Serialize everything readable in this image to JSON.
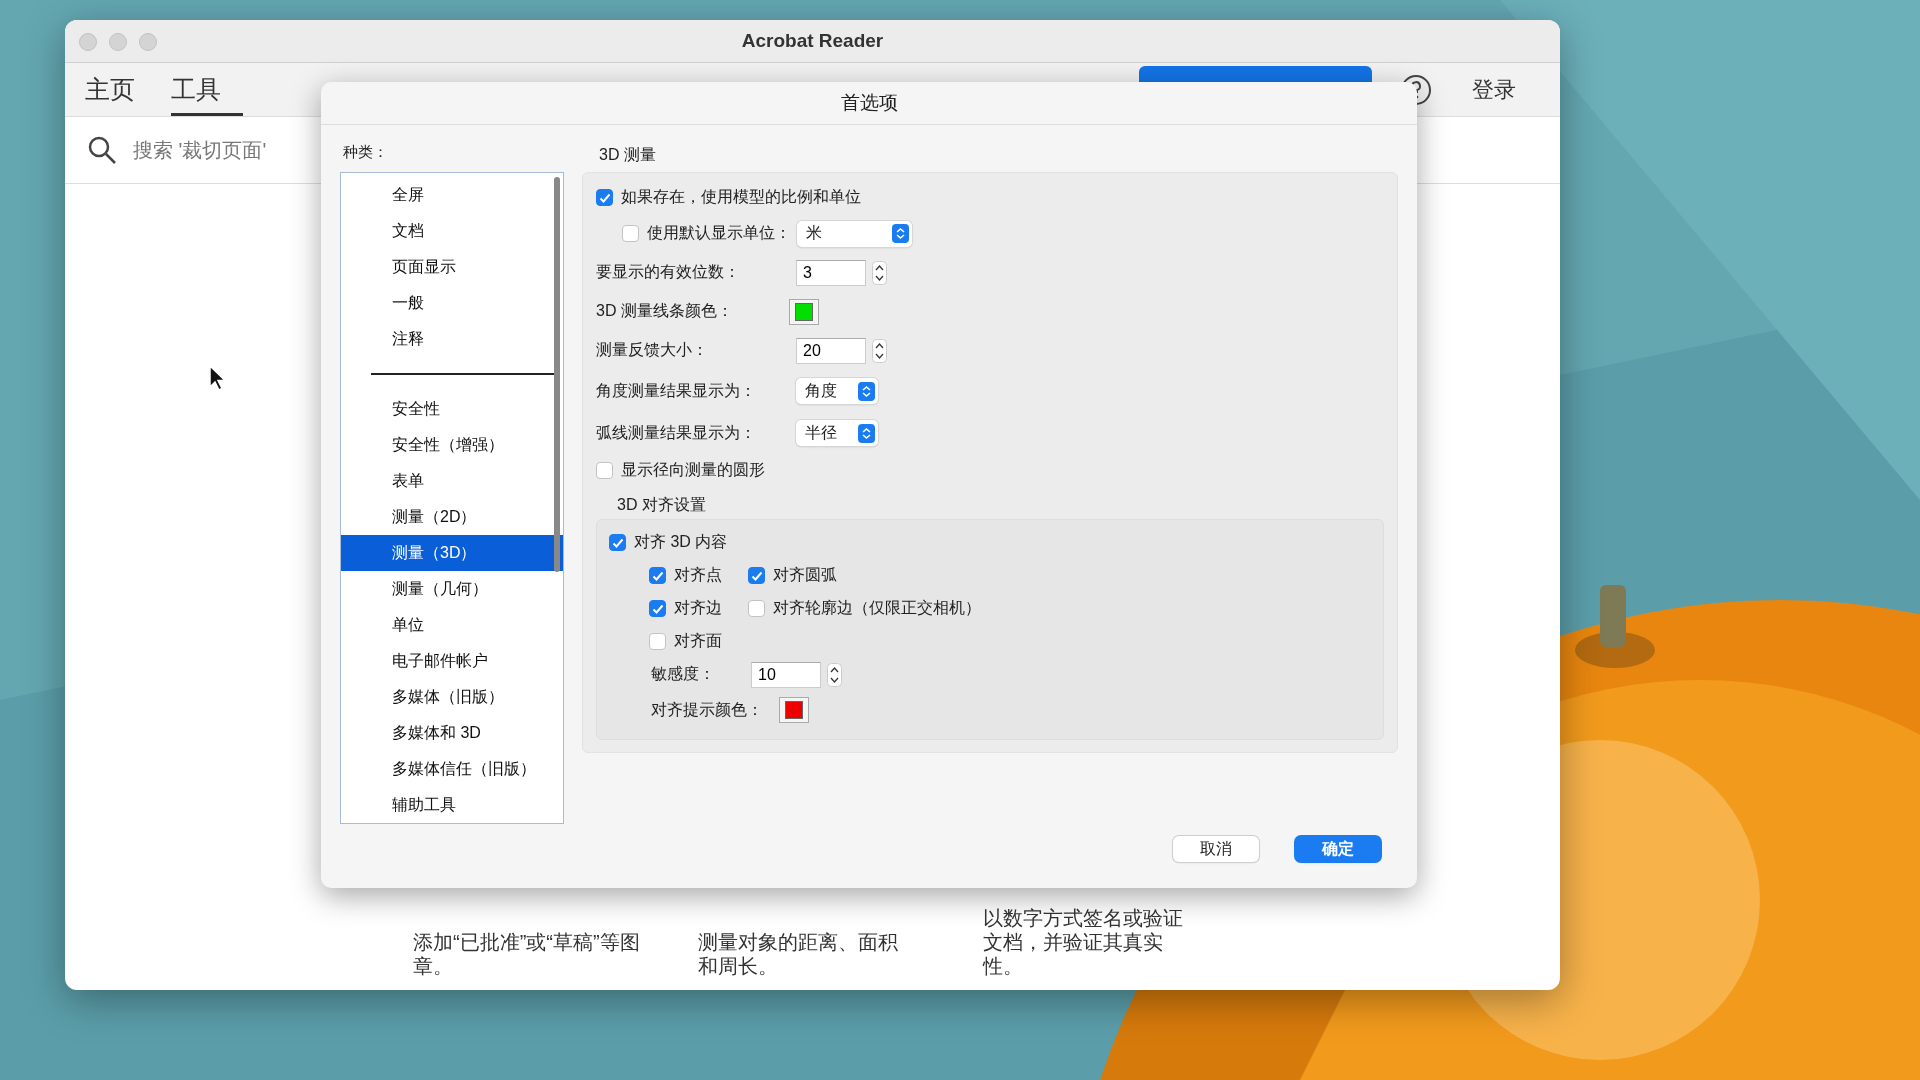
{
  "window": {
    "title": "Acrobat Reader"
  },
  "tabs": [
    {
      "label": "主页",
      "selected": false
    },
    {
      "label": "工具",
      "selected": true
    }
  ],
  "sign_in": "登录",
  "search": {
    "placeholder": "搜索 '裁切页面'"
  },
  "tool_descriptions": [
    "添加“已批准”或“草稿”等图章。",
    "测量对象的距离、面积和周长。",
    "以数字方式签名或验证文档，并验证其真实性。"
  ],
  "dialog": {
    "title": "首选项",
    "categories_label": "种类：",
    "category_groups": [
      [
        {
          "label": "全屏",
          "selected": false
        },
        {
          "label": "文档",
          "selected": false
        },
        {
          "label": "页面显示",
          "selected": false
        },
        {
          "label": "一般",
          "selected": false
        },
        {
          "label": "注释",
          "selected": false
        }
      ],
      [
        {
          "label": "安全性",
          "selected": false
        },
        {
          "label": "安全性（增强）",
          "selected": false
        },
        {
          "label": "表单",
          "selected": false
        },
        {
          "label": "测量（2D）",
          "selected": false
        },
        {
          "label": "测量（3D）",
          "selected": true
        },
        {
          "label": "测量（几何）",
          "selected": false
        },
        {
          "label": "单位",
          "selected": false
        },
        {
          "label": "电子邮件帐户",
          "selected": false
        },
        {
          "label": "多媒体（旧版）",
          "selected": false
        },
        {
          "label": "多媒体和 3D",
          "selected": false
        },
        {
          "label": "多媒体信任（旧版）",
          "selected": false
        },
        {
          "label": "辅助工具",
          "selected": false
        }
      ]
    ],
    "section_title": "3D 测量",
    "settings": [
      {
        "kind": "checkbox",
        "label": "如果存在，使用模型的比例和单位",
        "checked": true
      },
      {
        "kind": "checkbox-select",
        "label": "使用默认显示单位：",
        "checked": false,
        "value": "米"
      },
      {
        "kind": "spinner",
        "label": "要显示的有效位数：",
        "value": "3"
      },
      {
        "kind": "color",
        "label": "3D 测量线条颜色：",
        "color": "#00e000"
      },
      {
        "kind": "spinner",
        "label": "测量反馈大小：",
        "value": "20"
      },
      {
        "kind": "select",
        "label": "角度测量结果显示为：",
        "value": "角度"
      },
      {
        "kind": "select",
        "label": "弧线测量结果显示为：",
        "value": "半径"
      },
      {
        "kind": "checkbox",
        "label": "显示径向测量的圆形",
        "checked": false
      }
    ],
    "align_group": {
      "title": "3D 对齐设置",
      "master": {
        "label": "对齐 3D 内容",
        "checked": true
      },
      "option_rows": [
        [
          {
            "label": "对齐点",
            "checked": true
          },
          {
            "label": "对齐圆弧",
            "checked": true
          }
        ],
        [
          {
            "label": "对齐边",
            "checked": true
          },
          {
            "label": "对齐轮廓边（仅限正交相机）",
            "checked": false
          }
        ],
        [
          {
            "label": "对齐面",
            "checked": false
          }
        ]
      ],
      "sensitivity": {
        "label": "敏感度：",
        "value": "10"
      },
      "hint_color": {
        "label": "对齐提示颜色：",
        "color": "#ee0000"
      }
    },
    "buttons": [
      {
        "label": "取消",
        "kind": "secondary"
      },
      {
        "label": "确定",
        "kind": "primary"
      }
    ]
  }
}
